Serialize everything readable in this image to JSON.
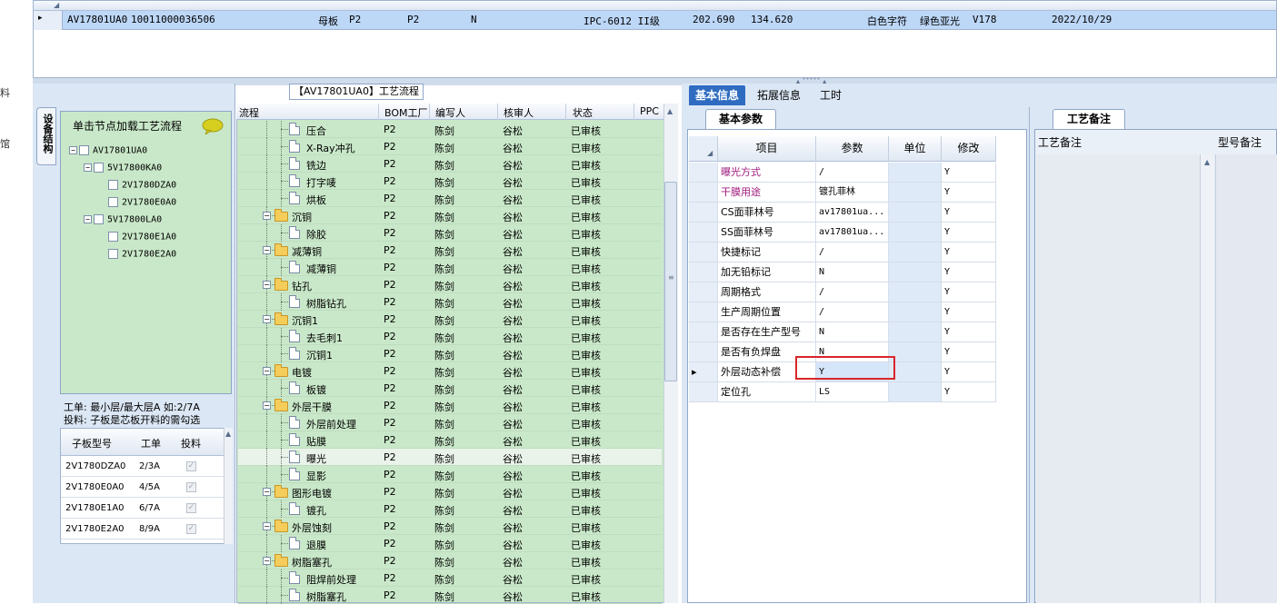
{
  "left_edge": {
    "chars": [
      "料",
      "馆"
    ]
  },
  "top_grid": {
    "row_marker": "▸",
    "cells": [
      "AV17801UA0",
      "10011000036506",
      "母板",
      "P2",
      "P2",
      "N",
      "IPC-6012 II级",
      "202.690",
      "134.620",
      "白色字符",
      "绿色亚光",
      "V178",
      "2022/10/29"
    ]
  },
  "left_panel": {
    "vertical_tab": "设备结构",
    "hint": "单击节点加载工艺流程",
    "tree": [
      {
        "label": "AV17801UA0",
        "level": 0,
        "expander": "−"
      },
      {
        "label": "5V17800KA0",
        "level": 1,
        "expander": "−"
      },
      {
        "label": "2V1780DZA0",
        "level": 2,
        "expander": ""
      },
      {
        "label": "2V1780E0A0",
        "level": 2,
        "expander": ""
      },
      {
        "label": "5V17800LA0",
        "level": 1,
        "expander": "−"
      },
      {
        "label": "2V1780E1A0",
        "level": 2,
        "expander": ""
      },
      {
        "label": "2V1780E2A0",
        "level": 2,
        "expander": ""
      }
    ],
    "info_line1": "工单: 最小层/最大层A 如:2/7A",
    "info_line2": "投料: 子板是芯板开料的需勾选",
    "sub_grid": {
      "headers": [
        "子板型号",
        "工单",
        "投料"
      ],
      "rows": [
        {
          "model": "2V1780DZA0",
          "order": "2/3A",
          "feed": "✓"
        },
        {
          "model": "2V1780E0A0",
          "order": "4/5A",
          "feed": "✓"
        },
        {
          "model": "2V1780E1A0",
          "order": "6/7A",
          "feed": "✓"
        },
        {
          "model": "2V1780E2A0",
          "order": "8/9A",
          "feed": "✓"
        }
      ]
    }
  },
  "flow": {
    "title": "【AV17801UA0】工艺流程",
    "headers": [
      "流程",
      "BOM工厂",
      "编写人",
      "核审人",
      "状态",
      "PPC"
    ],
    "rows": [
      {
        "name": "压合",
        "type": "doc",
        "bom": "P2",
        "writer": "陈剑",
        "reviewer": "谷松",
        "status": "已审核"
      },
      {
        "name": "X-Ray冲孔",
        "type": "doc",
        "bom": "P2",
        "writer": "陈剑",
        "reviewer": "谷松",
        "status": "已审核"
      },
      {
        "name": "铣边",
        "type": "doc",
        "bom": "P2",
        "writer": "陈剑",
        "reviewer": "谷松",
        "status": "已审核"
      },
      {
        "name": "打字唛",
        "type": "doc",
        "bom": "P2",
        "writer": "陈剑",
        "reviewer": "谷松",
        "status": "已审核"
      },
      {
        "name": "烘板",
        "type": "doc",
        "bom": "P2",
        "writer": "陈剑",
        "reviewer": "谷松",
        "status": "已审核"
      },
      {
        "name": "沉铜",
        "type": "folder",
        "bom": "P2",
        "writer": "陈剑",
        "reviewer": "谷松",
        "status": "已审核"
      },
      {
        "name": "除胶",
        "type": "doc",
        "bom": "P2",
        "writer": "陈剑",
        "reviewer": "谷松",
        "status": "已审核"
      },
      {
        "name": "减薄铜",
        "type": "folder",
        "bom": "P2",
        "writer": "陈剑",
        "reviewer": "谷松",
        "status": "已审核"
      },
      {
        "name": "减薄铜",
        "type": "doc",
        "bom": "P2",
        "writer": "陈剑",
        "reviewer": "谷松",
        "status": "已审核"
      },
      {
        "name": "钻孔",
        "type": "folder",
        "bom": "P2",
        "writer": "陈剑",
        "reviewer": "谷松",
        "status": "已审核"
      },
      {
        "name": "树脂钻孔",
        "type": "doc",
        "bom": "P2",
        "writer": "陈剑",
        "reviewer": "谷松",
        "status": "已审核"
      },
      {
        "name": "沉铜1",
        "type": "folder",
        "bom": "P2",
        "writer": "陈剑",
        "reviewer": "谷松",
        "status": "已审核"
      },
      {
        "name": "去毛刺1",
        "type": "doc",
        "bom": "P2",
        "writer": "陈剑",
        "reviewer": "谷松",
        "status": "已审核"
      },
      {
        "name": "沉铜1",
        "type": "doc",
        "bom": "P2",
        "writer": "陈剑",
        "reviewer": "谷松",
        "status": "已审核"
      },
      {
        "name": "电镀",
        "type": "folder",
        "bom": "P2",
        "writer": "陈剑",
        "reviewer": "谷松",
        "status": "已审核"
      },
      {
        "name": "板镀",
        "type": "doc",
        "bom": "P2",
        "writer": "陈剑",
        "reviewer": "谷松",
        "status": "已审核"
      },
      {
        "name": "外层干膜",
        "type": "folder",
        "bom": "P2",
        "writer": "陈剑",
        "reviewer": "谷松",
        "status": "已审核"
      },
      {
        "name": "外层前处理",
        "type": "doc",
        "bom": "P2",
        "writer": "陈剑",
        "reviewer": "谷松",
        "status": "已审核"
      },
      {
        "name": "贴膜",
        "type": "doc",
        "bom": "P2",
        "writer": "陈剑",
        "reviewer": "谷松",
        "status": "已审核"
      },
      {
        "name": "曝光",
        "type": "doc",
        "bom": "P2",
        "writer": "陈剑",
        "reviewer": "谷松",
        "status": "已审核",
        "selected": true
      },
      {
        "name": "显影",
        "type": "doc",
        "bom": "P2",
        "writer": "陈剑",
        "reviewer": "谷松",
        "status": "已审核"
      },
      {
        "name": "图形电镀",
        "type": "folder",
        "bom": "P2",
        "writer": "陈剑",
        "reviewer": "谷松",
        "status": "已审核"
      },
      {
        "name": "镀孔",
        "type": "doc",
        "bom": "P2",
        "writer": "陈剑",
        "reviewer": "谷松",
        "status": "已审核"
      },
      {
        "name": "外层蚀刻",
        "type": "folder",
        "bom": "P2",
        "writer": "陈剑",
        "reviewer": "谷松",
        "status": "已审核"
      },
      {
        "name": "退膜",
        "type": "doc",
        "bom": "P2",
        "writer": "陈剑",
        "reviewer": "谷松",
        "status": "已审核"
      },
      {
        "name": "树脂塞孔",
        "type": "folder",
        "bom": "P2",
        "writer": "陈剑",
        "reviewer": "谷松",
        "status": "已审核"
      },
      {
        "name": "阻焊前处理",
        "type": "doc",
        "bom": "P2",
        "writer": "陈剑",
        "reviewer": "谷松",
        "status": "已审核"
      },
      {
        "name": "树脂塞孔",
        "type": "doc",
        "bom": "P2",
        "writer": "陈剑",
        "reviewer": "谷松",
        "status": "已审核"
      }
    ]
  },
  "right": {
    "tabs": [
      "基本信息",
      "拓展信息",
      "工时"
    ],
    "active_tab": 0,
    "params_tab": "基本参数",
    "remarks_tab": "工艺备注",
    "params_headers": [
      "项目",
      "参数",
      "单位",
      "修改"
    ],
    "params": [
      {
        "item": "曝光方式",
        "value": "/",
        "unit": "",
        "edit": "Y",
        "color": "#a01a7d"
      },
      {
        "item": "干膜用途",
        "value": "镀孔菲林",
        "unit": "",
        "edit": "Y",
        "color": "#a01a7d"
      },
      {
        "item": "CS面菲林号",
        "value": "av17801ua...",
        "unit": "",
        "edit": "Y",
        "color": "#000000"
      },
      {
        "item": "SS面菲林号",
        "value": "av17801ua...",
        "unit": "",
        "edit": "Y",
        "color": "#000000"
      },
      {
        "item": "快捷标记",
        "value": "/",
        "unit": "",
        "edit": "Y",
        "color": "#000000"
      },
      {
        "item": "加无铅标记",
        "value": "N",
        "unit": "",
        "edit": "Y",
        "color": "#000000"
      },
      {
        "item": "周期格式",
        "value": "/",
        "unit": "",
        "edit": "Y",
        "color": "#000000"
      },
      {
        "item": "生产周期位置",
        "value": "/",
        "unit": "",
        "edit": "Y",
        "color": "#000000"
      },
      {
        "item": "是否存在生产型号",
        "value": "N",
        "unit": "",
        "edit": "Y",
        "color": "#000000"
      },
      {
        "item": "是否有负焊盘",
        "value": "N",
        "unit": "",
        "edit": "Y",
        "color": "#000000"
      },
      {
        "item": "外层动态补偿",
        "value": "Y",
        "unit": "",
        "edit": "Y",
        "color": "#000000",
        "current": true
      },
      {
        "item": "定位孔",
        "value": "LS",
        "unit": "",
        "edit": "Y",
        "color": "#000000"
      }
    ],
    "remarks_headers": [
      "工艺备注",
      "型号备注"
    ]
  },
  "colors": {
    "accent": "#2f6cc1",
    "tree_green": "#c9e8c9",
    "selection_row": "#bdd7f7",
    "highlight_red": "#d9262a"
  }
}
